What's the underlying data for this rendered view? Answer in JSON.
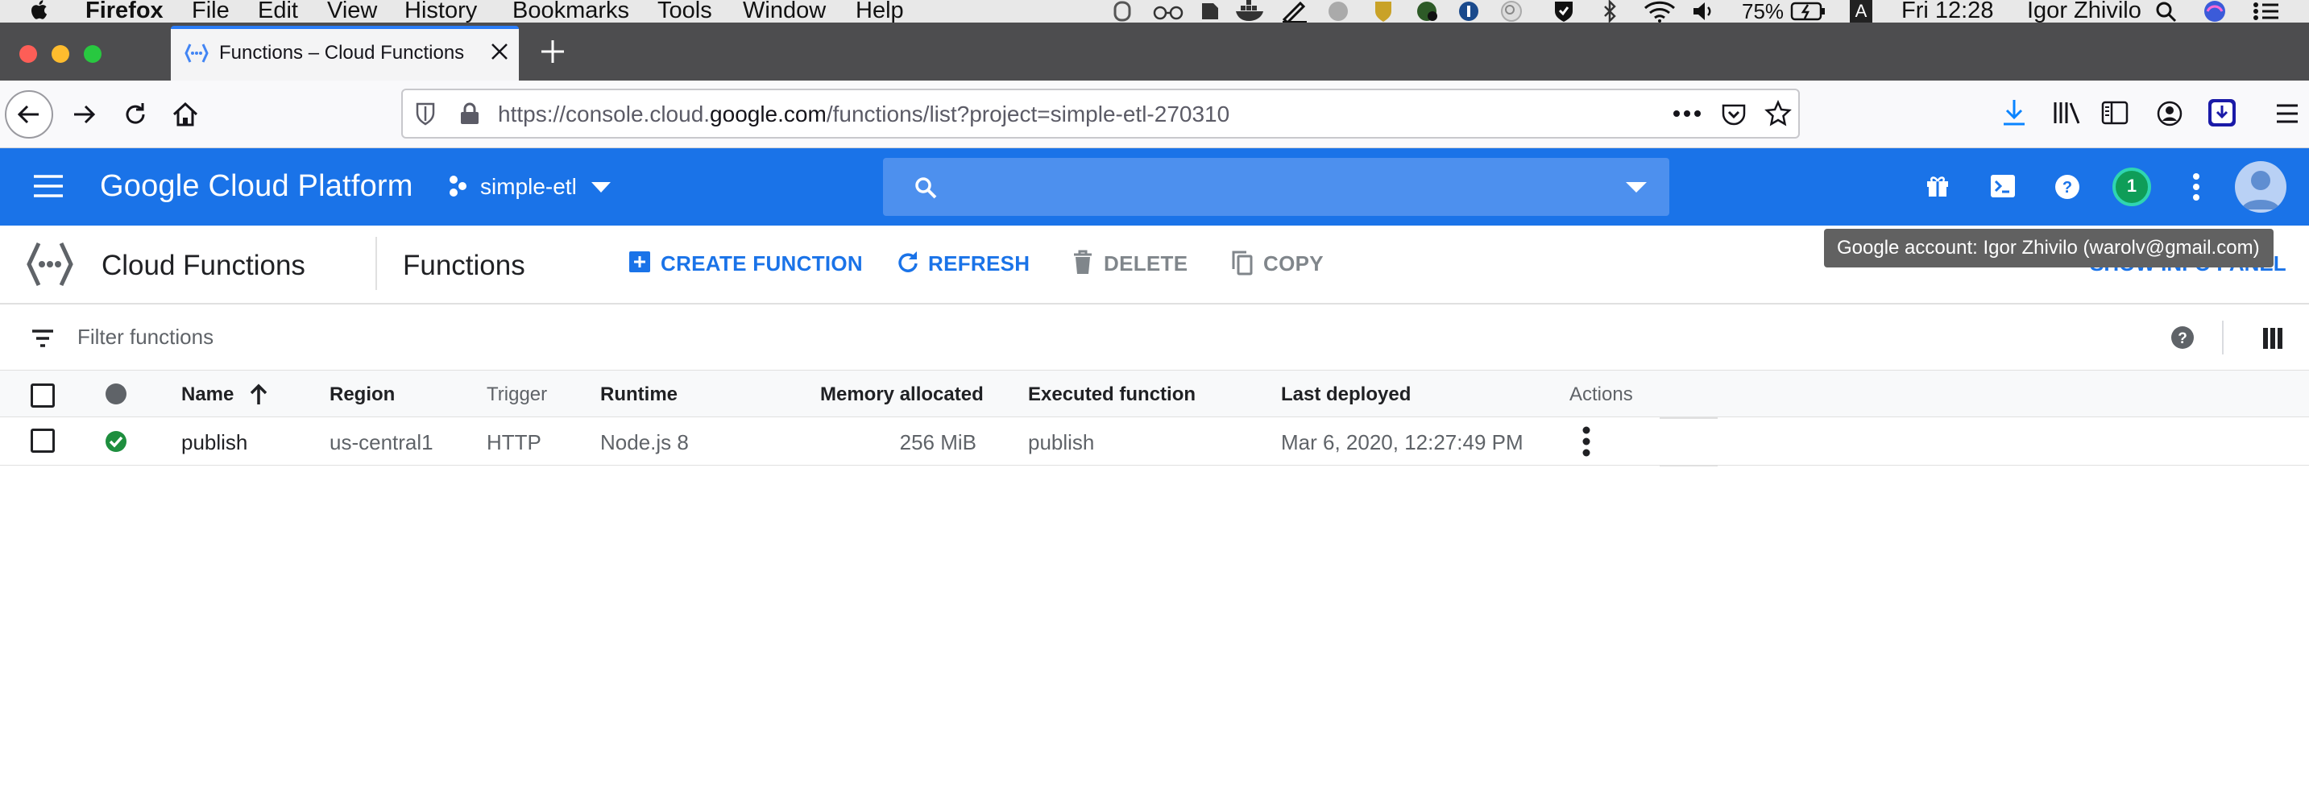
{
  "menubar": {
    "app": "Firefox",
    "items": [
      "File",
      "Edit",
      "View",
      "History",
      "Bookmarks",
      "Tools",
      "Window",
      "Help"
    ],
    "battery": "75%",
    "keyboard": "A",
    "clock": "Fri 12:28",
    "user": "Igor Zhivilo"
  },
  "browser": {
    "tab_title": "Functions – Cloud Functions – s",
    "url_prefix": "https://console.cloud.",
    "url_domain": "google.com",
    "url_rest": "/functions/list?project=simple-etl-270310"
  },
  "gcp": {
    "brand": "Google Cloud Platform",
    "project": "simple-etl",
    "notifications": "1",
    "tooltip": "Google account: Igor Zhivilo (warolv@gmail.com)"
  },
  "toolbar": {
    "product": "Cloud Functions",
    "page_title": "Functions",
    "create": "CREATE FUNCTION",
    "refresh": "REFRESH",
    "delete": "DELETE",
    "copy": "COPY",
    "info_panel": "SHOW INFO PANEL"
  },
  "filter": {
    "placeholder": "Filter functions"
  },
  "table": {
    "headers": {
      "name": "Name",
      "region": "Region",
      "trigger": "Trigger",
      "runtime": "Runtime",
      "memory": "Memory allocated",
      "executed": "Executed function",
      "deployed": "Last deployed",
      "actions": "Actions"
    },
    "rows": [
      {
        "name": "publish",
        "region": "us-central1",
        "trigger": "HTTP",
        "runtime": "Node.js 8",
        "memory": "256 MiB",
        "executed": "publish",
        "deployed": "Mar 6, 2020, 12:27:49 PM"
      }
    ]
  },
  "colors": {
    "gcp_blue": "#1a73e8",
    "status_ok": "#1e8e3e"
  }
}
